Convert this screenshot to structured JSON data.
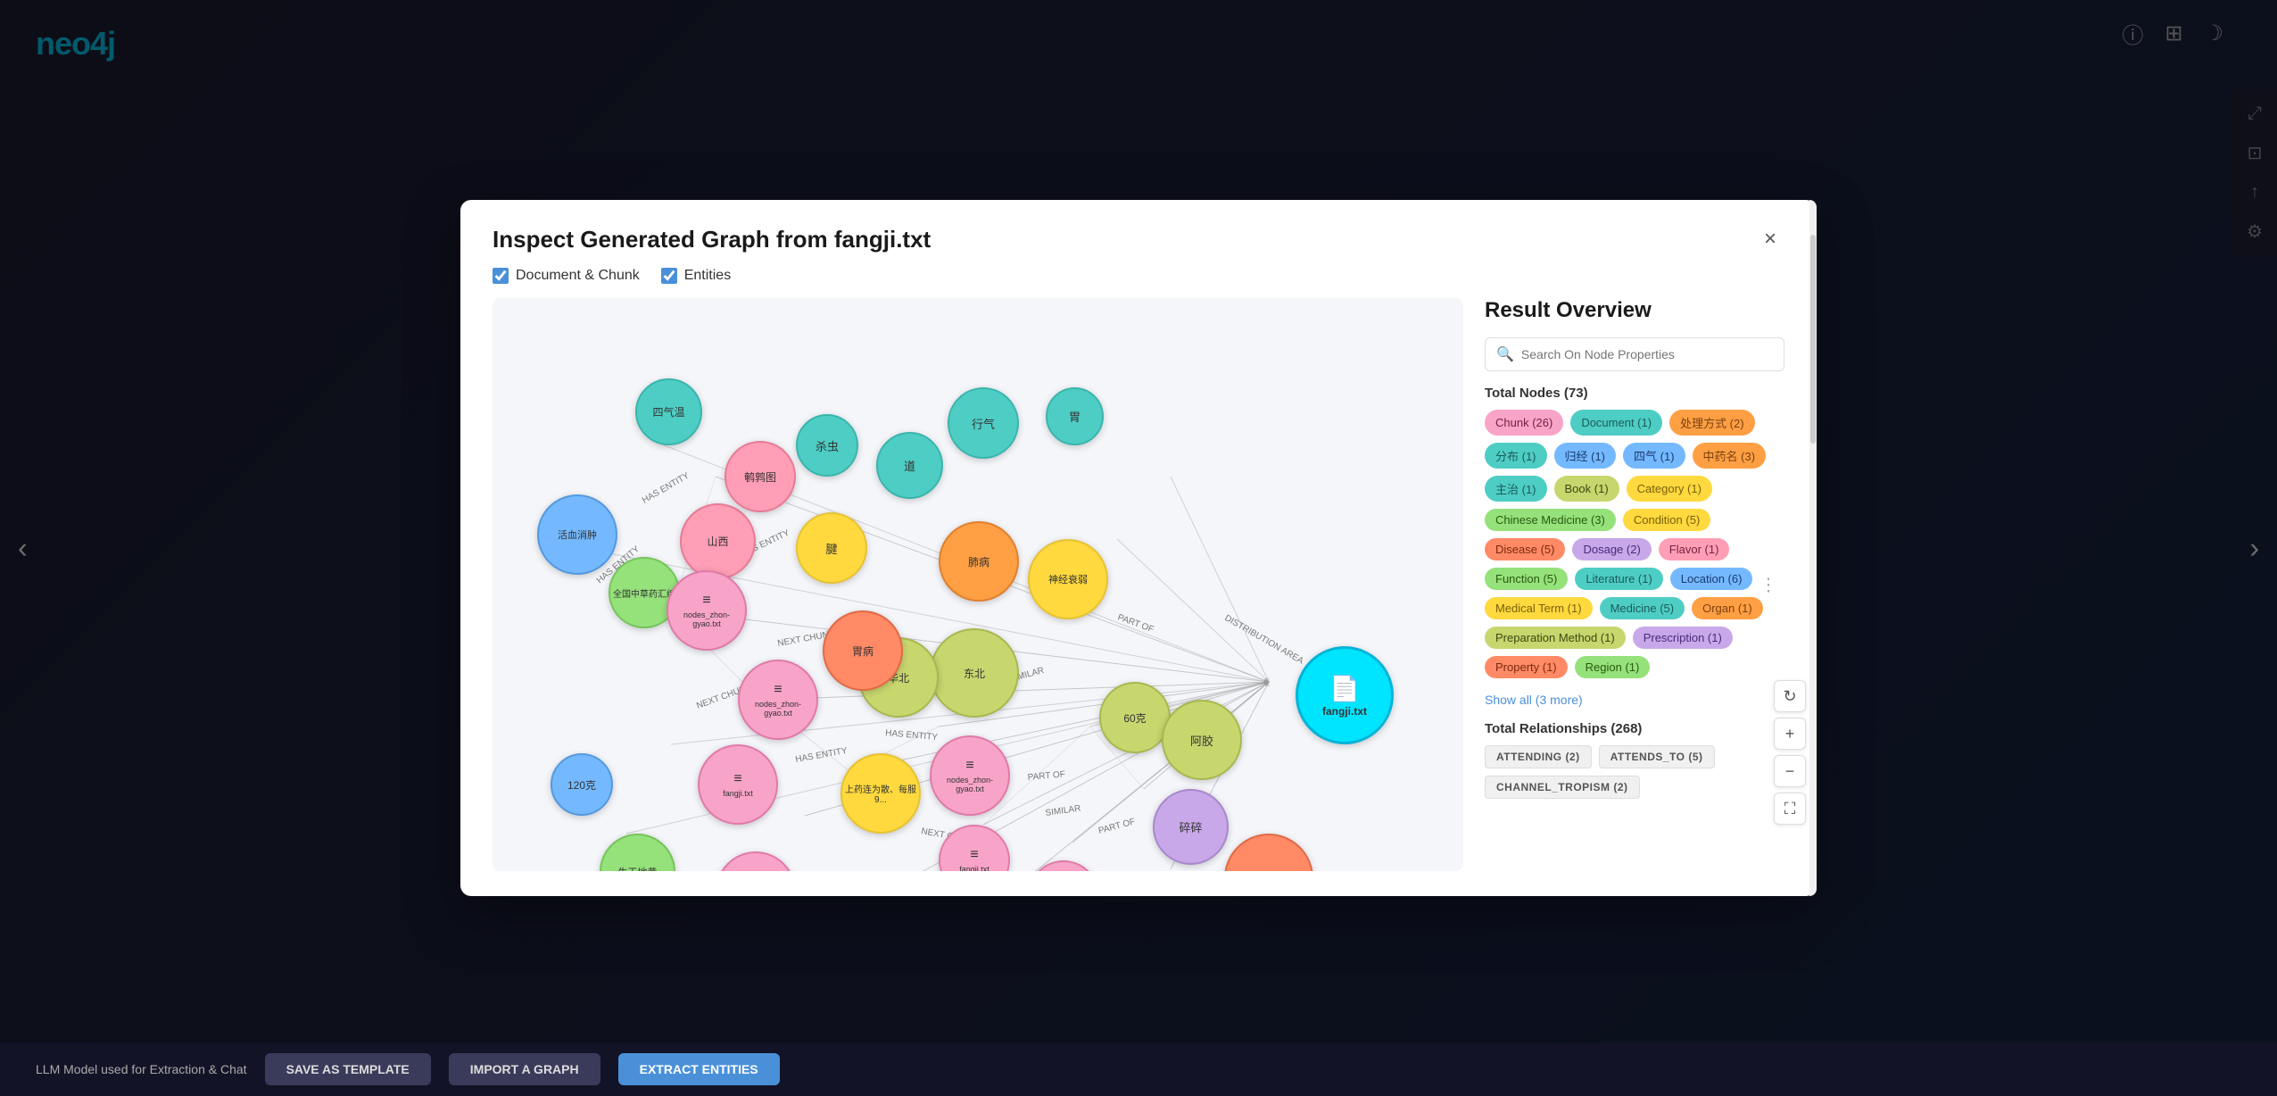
{
  "app": {
    "logo": "neo4j"
  },
  "modal": {
    "title": "Inspect Generated Graph from fangji.txt",
    "close_label": "×",
    "checkboxes": [
      {
        "label": "Document & Chunk",
        "checked": true
      },
      {
        "label": "Entities",
        "checked": true
      }
    ]
  },
  "result_panel": {
    "title": "Result Overview",
    "search_placeholder": "Search On Node Properties",
    "total_nodes_label": "Total Nodes (73)",
    "node_tags": [
      {
        "label": "Chunk (26)",
        "class": "tag-chunk"
      },
      {
        "label": "Document (1)",
        "class": "tag-document"
      },
      {
        "label": "处理方式 (2)",
        "class": "tag-process"
      },
      {
        "label": "分布 (1)",
        "class": "tag-distribute"
      },
      {
        "label": "归经 (1)",
        "class": "tag-guijing"
      },
      {
        "label": "四气 (1)",
        "class": "tag-siqi"
      },
      {
        "label": "中药名 (3)",
        "class": "tag-zhongyao"
      },
      {
        "label": "主治 (1)",
        "class": "tag-zhuzhi"
      },
      {
        "label": "Book (1)",
        "class": "tag-book"
      },
      {
        "label": "Category (1)",
        "class": "tag-category"
      },
      {
        "label": "Chinese Medicine (3)",
        "class": "tag-chinese-med"
      },
      {
        "label": "Condition (5)",
        "class": "tag-condition"
      },
      {
        "label": "Disease (5)",
        "class": "tag-disease"
      },
      {
        "label": "Dosage (2)",
        "class": "tag-dosage"
      },
      {
        "label": "Flavor (1)",
        "class": "tag-flavor"
      },
      {
        "label": "Function (5)",
        "class": "tag-function"
      },
      {
        "label": "Literature (1)",
        "class": "tag-literature"
      },
      {
        "label": "Location (6)",
        "class": "tag-location"
      },
      {
        "label": "Medical Term (1)",
        "class": "tag-medical"
      },
      {
        "label": "Medicine (5)",
        "class": "tag-medicine"
      },
      {
        "label": "Organ (1)",
        "class": "tag-organ"
      },
      {
        "label": "Preparation Method (1)",
        "class": "tag-prep"
      },
      {
        "label": "Prescription (1)",
        "class": "tag-prescription"
      },
      {
        "label": "Property (1)",
        "class": "tag-property"
      },
      {
        "label": "Region (1)",
        "class": "tag-region"
      }
    ],
    "show_more_label": "Show all (3 more)",
    "total_relationships_label": "Total Relationships (268)",
    "rel_tags": [
      {
        "label": "ATTENDING (2)"
      },
      {
        "label": "ATTENDS_TO (5)"
      },
      {
        "label": "CHANNEL_TROPISM (2)"
      }
    ]
  },
  "graph_controls": {
    "refresh_icon": "↻",
    "zoom_in_icon": "+",
    "zoom_out_icon": "−",
    "fullscreen_icon": "⛶"
  },
  "bottom_bar": {
    "label": "LLM Model used for Extraction & Chat",
    "btn1": "SAVE AS TEMPLATE",
    "btn2": "IMPORT A GRAPH",
    "btn3": "EXTRACT ENTITIES"
  }
}
